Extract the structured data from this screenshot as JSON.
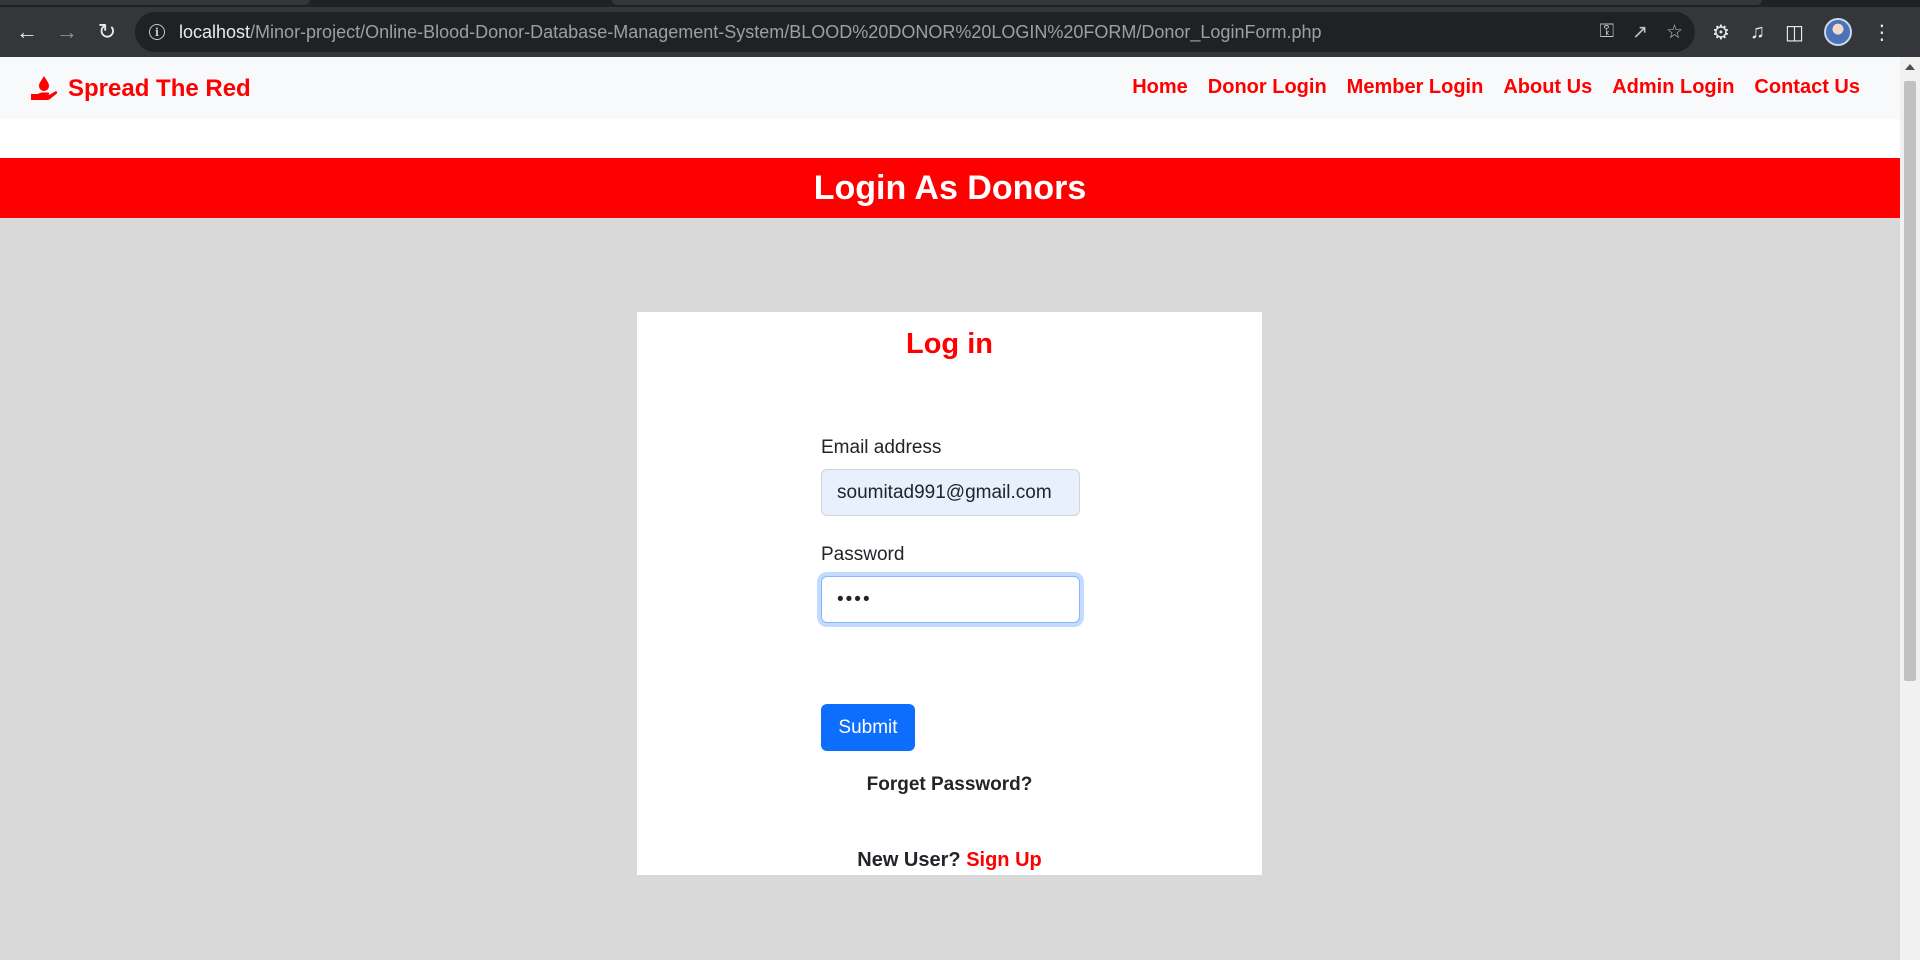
{
  "browser": {
    "url_host": "localhost",
    "url_path": "/Minor-project/Online-Blood-Donor-Database-Management-System/BLOOD%20DONOR%20LOGIN%20FORM/Donor_LoginForm.php",
    "icons": {
      "back": "back-arrow-icon",
      "forward": "forward-arrow-icon",
      "reload": "reload-icon",
      "info": "site-info-icon",
      "key": "key-icon",
      "share": "share-icon",
      "star": "bookmark-star-icon",
      "extensions": "puzzle-icon",
      "media": "media-queue-icon",
      "sidepanel": "side-panel-icon",
      "profile": "avatar",
      "menu": "kebab-menu-icon"
    }
  },
  "navbar": {
    "brand": "Spread The Red",
    "brand_icon": "hand-holding-drop-icon",
    "links": [
      "Home",
      "Donor Login",
      "Member Login",
      "About Us",
      "Admin Login",
      "Contact Us"
    ]
  },
  "banner": {
    "title": "Login As Donors"
  },
  "login": {
    "title": "Log in",
    "email_label": "Email address",
    "email_value": "soumitad991@gmail.com",
    "password_label": "Password",
    "password_value": "1234",
    "submit_label": "Submit",
    "forget_label": "Forget Password?",
    "new_user_label": "New User?",
    "signup_label": "Sign Up"
  },
  "colors": {
    "brand_red": "#ff0000",
    "button_blue": "#0d6efd",
    "page_gray": "#d9d9d9"
  }
}
